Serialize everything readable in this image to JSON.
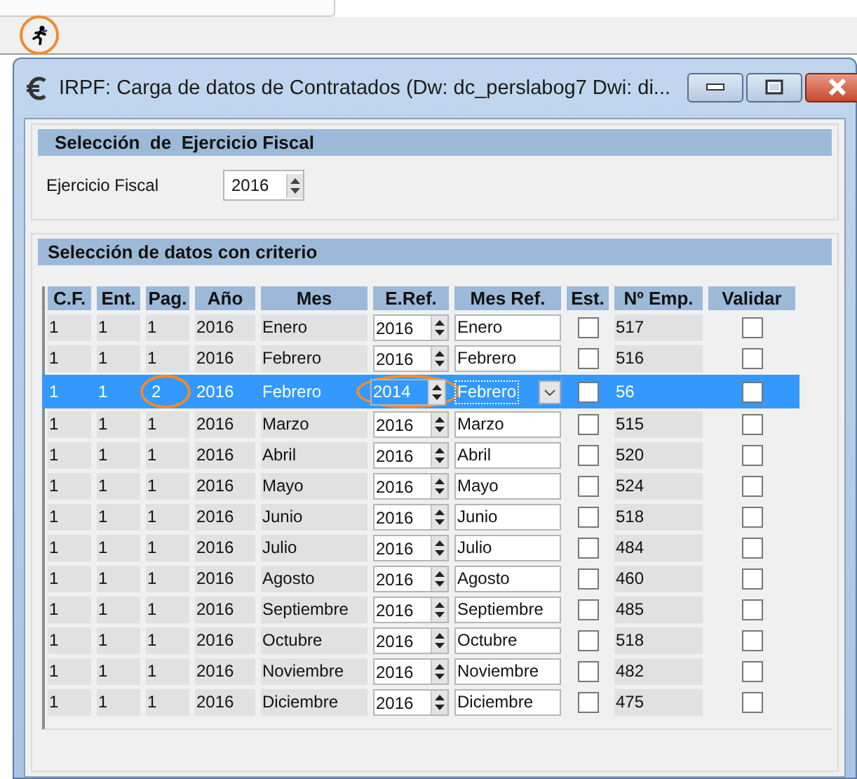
{
  "toolbar": {
    "button": {
      "circled": true
    }
  },
  "window": {
    "title": "IRPF: Carga de datos de Contratados (Dw: dc_perslabog7 Dwi: di..."
  },
  "fiscal_panel": {
    "title": "Selección  de  Ejercicio Fiscal",
    "field_label": "Ejercicio Fiscal",
    "field_value": "2016"
  },
  "data_panel": {
    "title": "Selección de datos con criterio",
    "columns": [
      "C.F.",
      "Ent.",
      "Pag.",
      "Año",
      "Mes",
      "E.Ref.",
      "Mes Ref.",
      "Est.",
      "Nº Emp.",
      "Validar"
    ],
    "rows": [
      {
        "cf": "1",
        "ent": "1",
        "pag": "1",
        "ano": "2016",
        "mes": "Enero",
        "e_ref": "2016",
        "mes_ref": "Enero",
        "est": false,
        "num_emp": "517",
        "validar": false,
        "selected": false
      },
      {
        "cf": "1",
        "ent": "1",
        "pag": "1",
        "ano": "2016",
        "mes": "Febrero",
        "e_ref": "2016",
        "mes_ref": "Febrero",
        "est": false,
        "num_emp": "516",
        "validar": false,
        "selected": false
      },
      {
        "cf": "1",
        "ent": "1",
        "pag": "2",
        "ano": "2016",
        "mes": "Febrero",
        "e_ref": "2014",
        "mes_ref": "Febrero",
        "est": false,
        "num_emp": "56",
        "validar": false,
        "selected": true,
        "pag_circled": true,
        "e_ref_circled": true
      },
      {
        "cf": "1",
        "ent": "1",
        "pag": "1",
        "ano": "2016",
        "mes": "Marzo",
        "e_ref": "2016",
        "mes_ref": "Marzo",
        "est": false,
        "num_emp": "515",
        "validar": false,
        "selected": false
      },
      {
        "cf": "1",
        "ent": "1",
        "pag": "1",
        "ano": "2016",
        "mes": "Abril",
        "e_ref": "2016",
        "mes_ref": "Abril",
        "est": false,
        "num_emp": "520",
        "validar": false,
        "selected": false
      },
      {
        "cf": "1",
        "ent": "1",
        "pag": "1",
        "ano": "2016",
        "mes": "Mayo",
        "e_ref": "2016",
        "mes_ref": "Mayo",
        "est": false,
        "num_emp": "524",
        "validar": false,
        "selected": false
      },
      {
        "cf": "1",
        "ent": "1",
        "pag": "1",
        "ano": "2016",
        "mes": "Junio",
        "e_ref": "2016",
        "mes_ref": "Junio",
        "est": false,
        "num_emp": "518",
        "validar": false,
        "selected": false
      },
      {
        "cf": "1",
        "ent": "1",
        "pag": "1",
        "ano": "2016",
        "mes": "Julio",
        "e_ref": "2016",
        "mes_ref": "Julio",
        "est": false,
        "num_emp": "484",
        "validar": false,
        "selected": false
      },
      {
        "cf": "1",
        "ent": "1",
        "pag": "1",
        "ano": "2016",
        "mes": "Agosto",
        "e_ref": "2016",
        "mes_ref": "Agosto",
        "est": false,
        "num_emp": "460",
        "validar": false,
        "selected": false
      },
      {
        "cf": "1",
        "ent": "1",
        "pag": "1",
        "ano": "2016",
        "mes": "Septiembre",
        "e_ref": "2016",
        "mes_ref": "Septiembre",
        "est": false,
        "num_emp": "485",
        "validar": false,
        "selected": false
      },
      {
        "cf": "1",
        "ent": "1",
        "pag": "1",
        "ano": "2016",
        "mes": "Octubre",
        "e_ref": "2016",
        "mes_ref": "Octubre",
        "est": false,
        "num_emp": "518",
        "validar": false,
        "selected": false
      },
      {
        "cf": "1",
        "ent": "1",
        "pag": "1",
        "ano": "2016",
        "mes": "Noviembre",
        "e_ref": "2016",
        "mes_ref": "Noviembre",
        "est": false,
        "num_emp": "482",
        "validar": false,
        "selected": false
      },
      {
        "cf": "1",
        "ent": "1",
        "pag": "1",
        "ano": "2016",
        "mes": "Diciembre",
        "e_ref": "2016",
        "mes_ref": "Diciembre",
        "est": false,
        "num_emp": "475",
        "validar": false,
        "selected": false
      }
    ]
  }
}
